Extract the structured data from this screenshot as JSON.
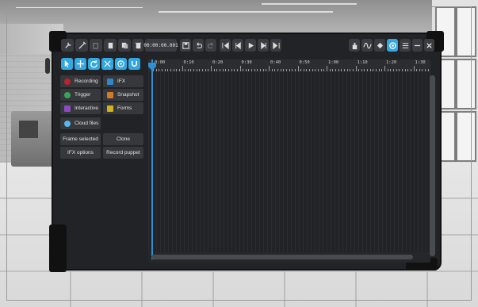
{
  "toolbar": {
    "timecode": "00:00:00.001",
    "left_icons": [
      "wrench-icon",
      "settings-tool-icon",
      "copy-icon",
      "paste-icon",
      "page-icon",
      "trash-icon"
    ],
    "transport_icons": [
      "save-icon",
      "undo-icon",
      "redo-icon",
      "skip-to-start-icon",
      "step-back-icon",
      "play-icon",
      "step-forward-icon",
      "skip-to-end-icon"
    ],
    "right_icons": [
      "hand-icon",
      "curve-icon",
      "keyframe-icon",
      "record-target-icon",
      "menu-icon",
      "minimize-icon",
      "close-icon"
    ],
    "tool_icons": [
      "select-arrow-icon",
      "move-icon",
      "rotate-icon",
      "scale-icon",
      "orbit-icon",
      "magnet-icon"
    ]
  },
  "panel": {
    "recording": "Recording",
    "ifx": "IFX",
    "trigger": "Trigger",
    "snapshot": "Snapshot",
    "interactive": "Interactive",
    "forms": "Forms",
    "cloud_files": "Cloud files",
    "frame_selected": "Frame selected",
    "clone": "Clone",
    "ifx_options": "IFX options",
    "record_puppet": "Record puppet"
  },
  "timeline": {
    "labels": [
      "0:00",
      "0:10",
      "0:20",
      "0:30",
      "0:40",
      "0:50",
      "1:00",
      "1:10",
      "1:20",
      "1:30"
    ]
  },
  "colors": {
    "accent": "#34a7e0",
    "panel_bg": "#222326",
    "button_bg": "#37383c"
  }
}
